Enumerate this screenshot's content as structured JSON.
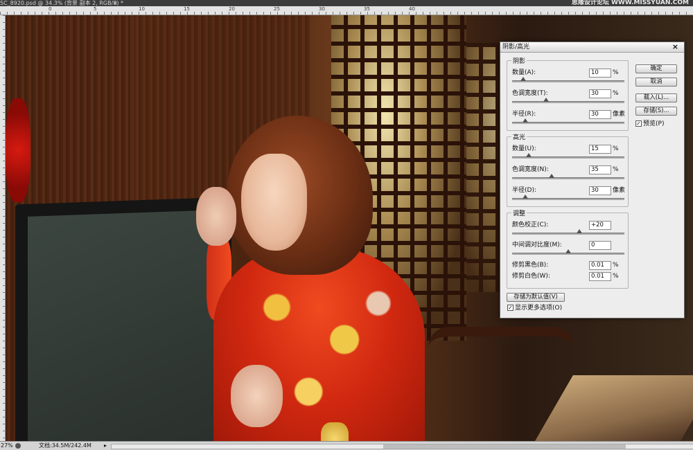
{
  "document_tab": {
    "title": "SC_8920.psd @ 34.3% (背景 副本 2, RGB/8) *",
    "close": "×",
    "watermark": "思缘设计论坛 WWW.MISSYUAN.COM"
  },
  "ruler": {
    "top_labels": [
      "0",
      "5",
      "10",
      "15",
      "20",
      "25",
      "30",
      "35",
      "40"
    ]
  },
  "dialog": {
    "title": "阴影/高光",
    "close": "×",
    "shadows": {
      "legend": "阴影",
      "rows": [
        {
          "label": "数量(A):",
          "value": "10",
          "unit": "%",
          "slider": 0.1
        },
        {
          "label": "色调宽度(T):",
          "value": "30",
          "unit": "%",
          "slider": 0.3
        },
        {
          "label": "半径(R):",
          "value": "30",
          "unit": "像素",
          "slider": 0.12
        }
      ]
    },
    "highlights": {
      "legend": "高光",
      "rows": [
        {
          "label": "数量(U):",
          "value": "15",
          "unit": "%",
          "slider": 0.15
        },
        {
          "label": "色调宽度(N):",
          "value": "35",
          "unit": "%",
          "slider": 0.35
        },
        {
          "label": "半径(D):",
          "value": "30",
          "unit": "像素",
          "slider": 0.12
        }
      ]
    },
    "adjustments": {
      "legend": "调整",
      "rows": [
        {
          "label": "颜色校正(C):",
          "value": "+20",
          "unit": "",
          "slider": 0.6
        },
        {
          "label": "中间调对比度(M):",
          "value": "0",
          "unit": "",
          "slider": 0.5
        },
        {
          "label": "修剪黑色(B):",
          "value": "0.01",
          "unit": "%"
        },
        {
          "label": "修剪白色(W):",
          "value": "0.01",
          "unit": "%"
        }
      ]
    },
    "buttons": {
      "ok": "确定",
      "cancel": "取消",
      "load": "载入(L)...",
      "save": "存储(S)...",
      "preview_label": "预览(P)",
      "preview_checked": true,
      "save_defaults": "存储为默认值(V)",
      "show_more_label": "显示更多选项(O)",
      "show_more_checked": true
    }
  },
  "statusbar": {
    "zoom": "27%",
    "doc_info": "文档:34.5M/242.4M",
    "arrow": "▸"
  }
}
